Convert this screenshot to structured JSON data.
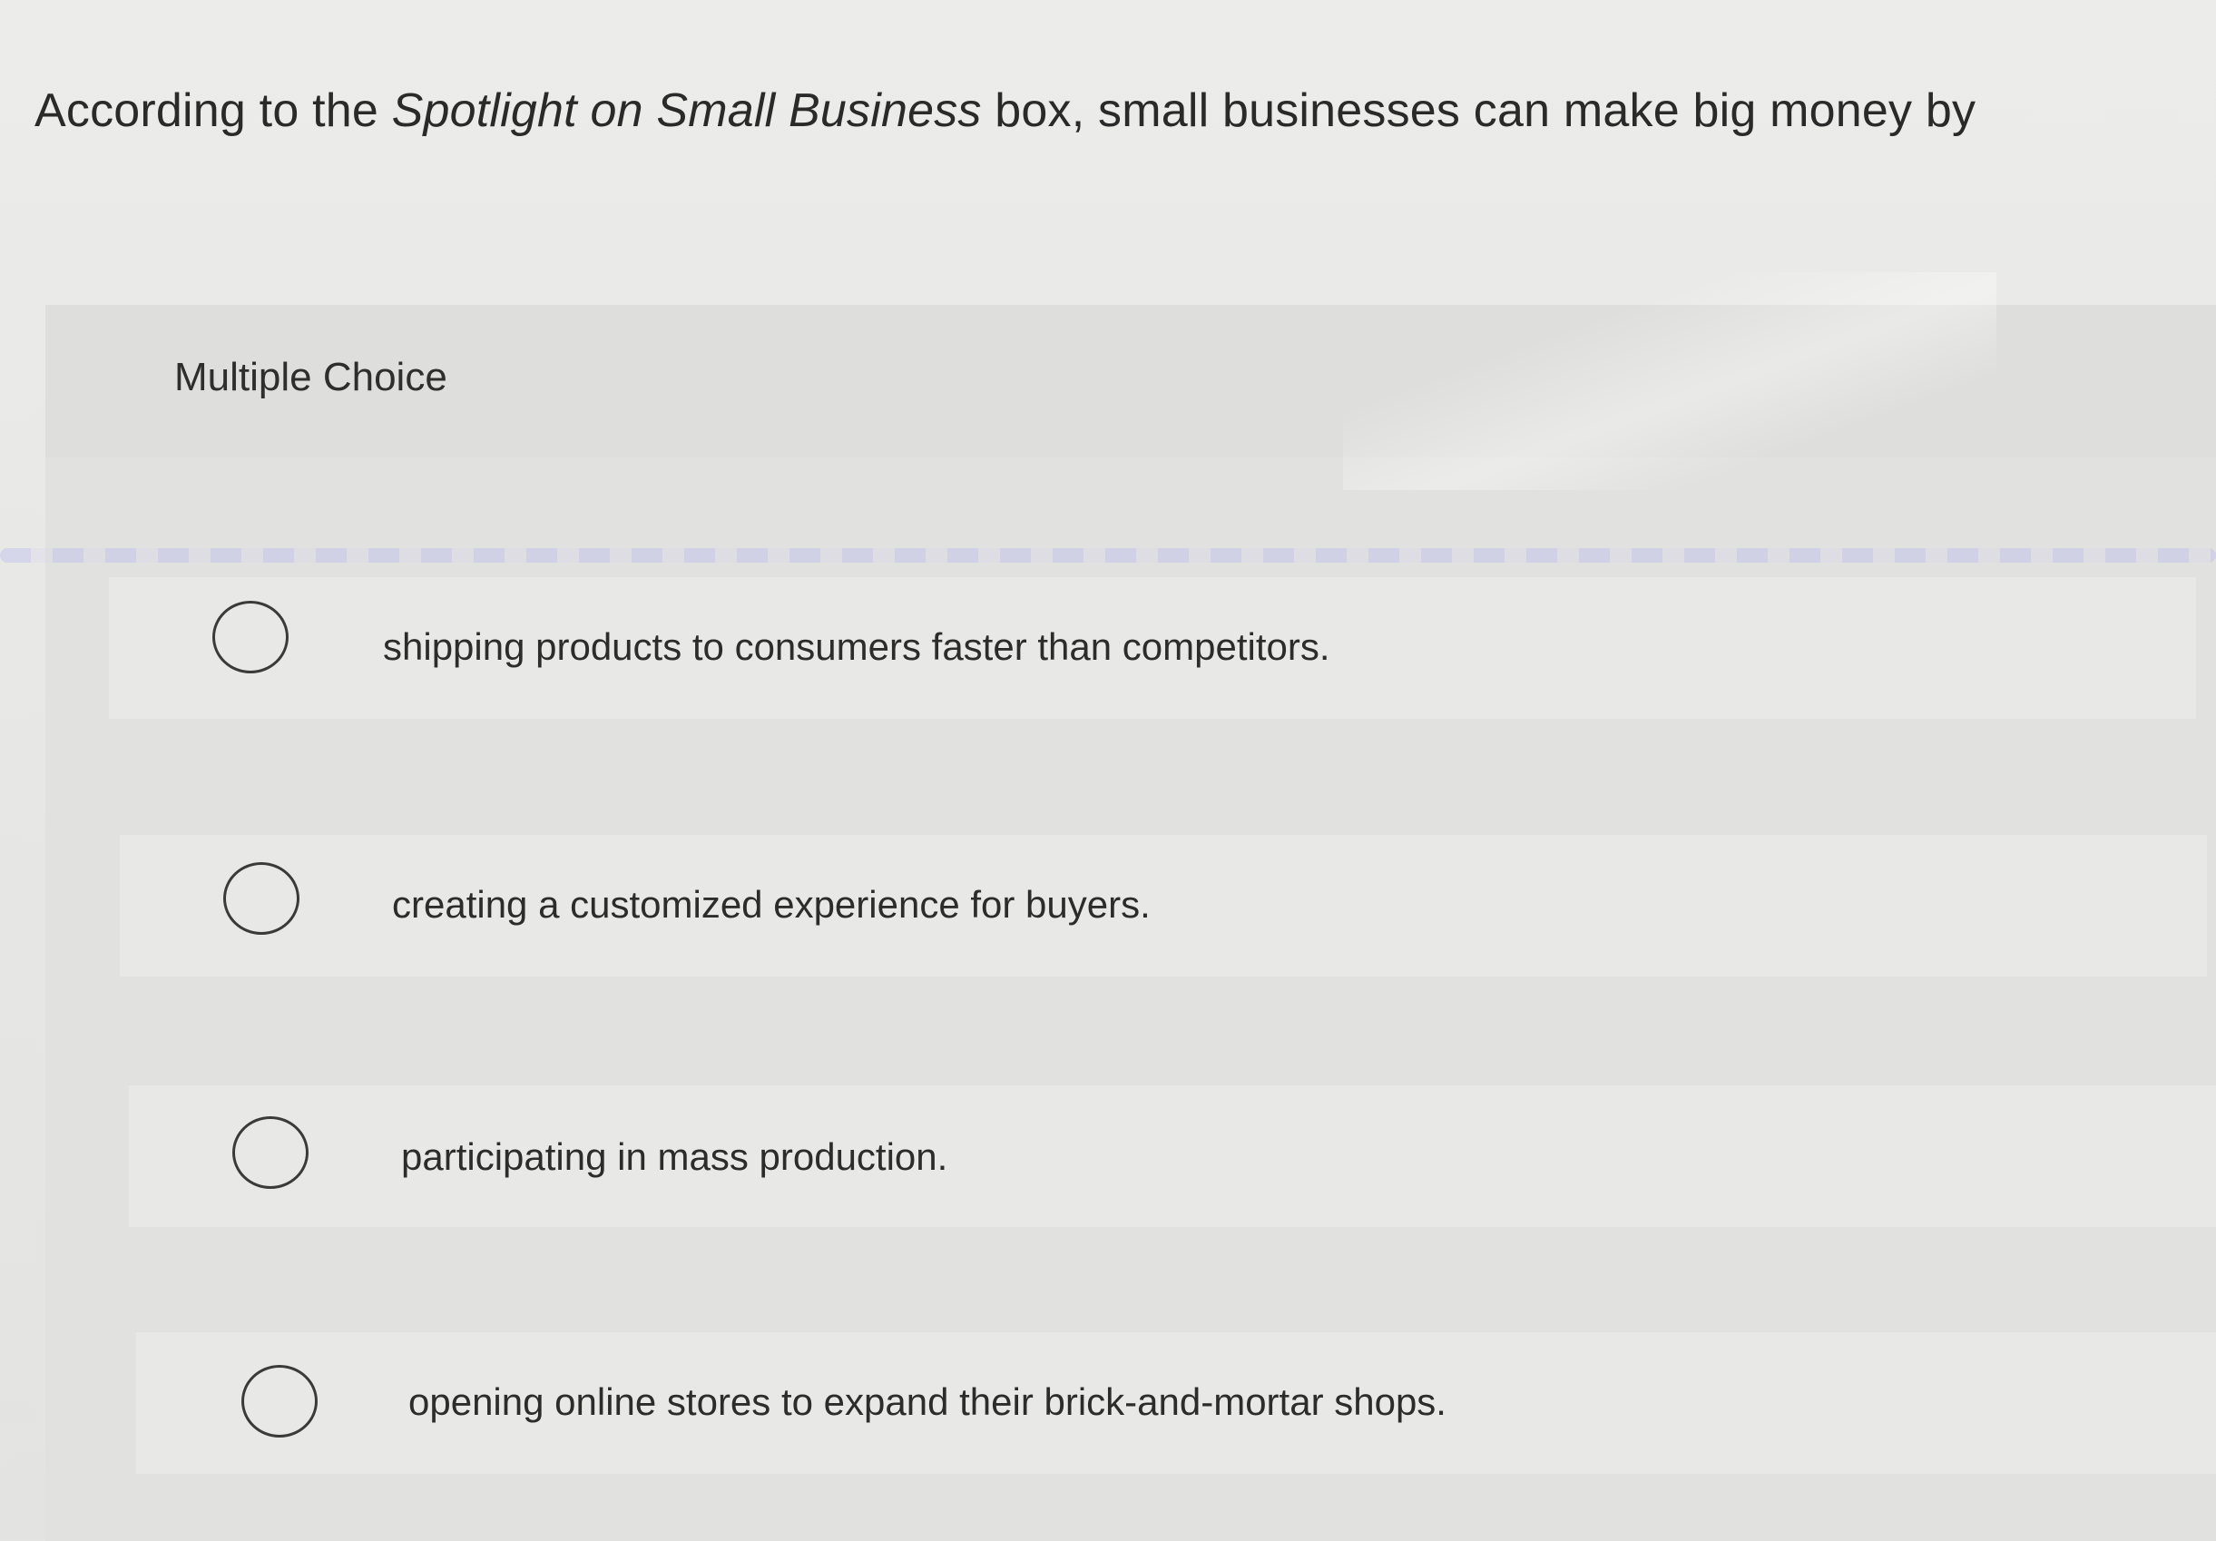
{
  "question": {
    "prefix": "According to the ",
    "emphasis": "Spotlight on Small Business",
    "suffix": " box, small businesses can make big money by"
  },
  "section": {
    "label": "Multiple Choice"
  },
  "options": [
    {
      "label": "shipping products to consumers faster than competitors.",
      "selected": false
    },
    {
      "label": "creating a customized experience for buyers.",
      "selected": false
    },
    {
      "label": "participating in mass production.",
      "selected": false
    },
    {
      "label": "opening online stores to expand their brick-and-mortar shops.",
      "selected": false
    }
  ],
  "icons": {
    "radio": "radio-unselected-icon"
  },
  "colors": {
    "background": "#e9e9e7",
    "panel": "#e1e1df",
    "text": "#2b2b2b",
    "radio_border": "#3a3a3a"
  }
}
